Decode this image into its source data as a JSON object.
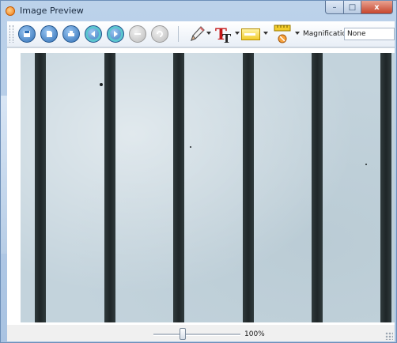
{
  "window": {
    "title": "Image Preview",
    "minimize_glyph": "–",
    "maximize_glyph": "□",
    "close_glyph": "x"
  },
  "toolbar": {
    "buttons": [
      {
        "icon": "save-icon"
      },
      {
        "icon": "open-icon"
      },
      {
        "icon": "print-icon"
      },
      {
        "icon": "back-icon"
      },
      {
        "icon": "forward-icon"
      },
      {
        "icon": "zoom-out-icon"
      },
      {
        "icon": "rotate-icon"
      }
    ],
    "tools": [
      "pencil-icon",
      "text-icon",
      "label-icon",
      "measure-icon"
    ],
    "magnification_label": "Magnification:",
    "magnification_value": "None"
  },
  "status": {
    "zoom_text": "100%",
    "zoom_slider_fraction": 0.3
  },
  "colors": {
    "specimen_background": "#c3d3dc",
    "ruler_lines": "#1f2628",
    "accent_blue": "#2f6fb6"
  }
}
